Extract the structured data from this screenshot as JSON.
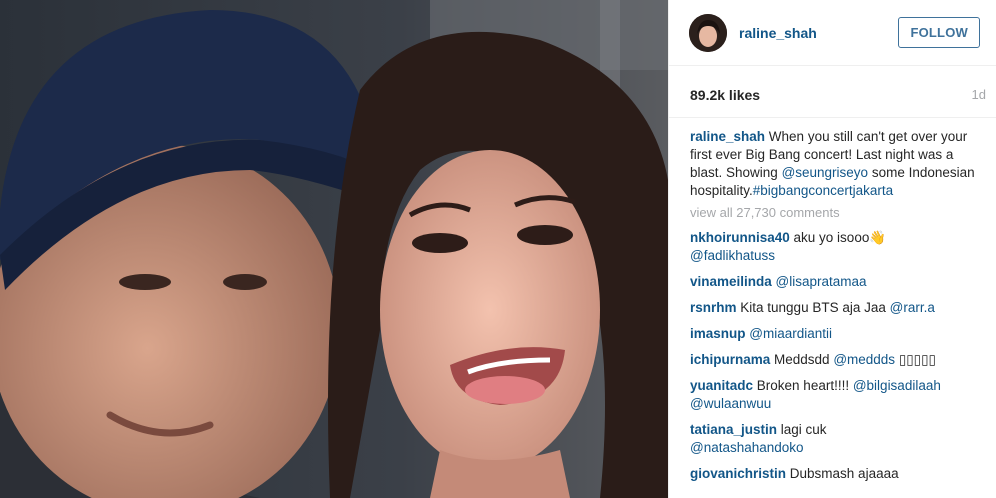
{
  "post": {
    "username": "raline_shah",
    "follow_label": "FOLLOW",
    "likes": "89.2k likes",
    "age": "1d",
    "caption": {
      "user": "raline_shah",
      "text": " When you still can't get over your first ever Big Bang concert! Last night was a blast. Showing ",
      "mention": "@seungriseyo",
      "text2": " some Indonesian hospitality.",
      "hashtag": "#bigbangconcertjakarta"
    },
    "view_all_comments": "view all 27,730 comments"
  },
  "comments": [
    {
      "user": "nkhoirunnisa40",
      "text": " aku yo isooo",
      "emoji": "👋",
      "mention": "@fadlikhatuss"
    },
    {
      "user": "vinameilinda",
      "text": " ",
      "mention": "@lisapratamaa"
    },
    {
      "user": "rsnrhm",
      "text": " Kita tunggu BTS aja Jaa ",
      "mention": "@rarr.a"
    },
    {
      "user": "imasnup",
      "text": " ",
      "mention": "@miaardiantii"
    },
    {
      "user": "ichipurnama",
      "text": " Meddsdd ",
      "mention": "@meddds",
      "tail": " ▯▯▯▯▯"
    },
    {
      "user": "yuanitadc",
      "text": " Broken heart!!!! ",
      "mention": "@bilgisadilaah @wulaanwuu"
    },
    {
      "user": "tatiana_justin",
      "text": " lagi cuk ",
      "mention": "@natashahandoko"
    },
    {
      "user": "giovanichristin",
      "text": " Dubsmash ajaaaa",
      "mention": ""
    }
  ],
  "colors": {
    "link": "#125688",
    "follow": "#3f729b",
    "muted": "#a5a7aa"
  },
  "icons": [
    "wave-emoji-icon"
  ]
}
